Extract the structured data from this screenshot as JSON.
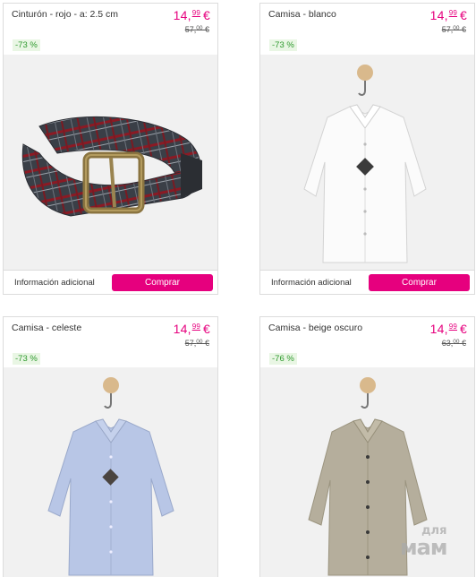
{
  "products": [
    {
      "title": "Cinturón - rojo - a: 2.5 cm",
      "price_int": "14,",
      "price_dec": "99",
      "currency": "€",
      "old_int": "57,",
      "old_dec": "00",
      "old_currency": "€",
      "discount": "-73 %",
      "info_label": "Información adicional",
      "buy_label": "Comprar"
    },
    {
      "title": "Camisa - blanco",
      "price_int": "14,",
      "price_dec": "99",
      "currency": "€",
      "old_int": "57,",
      "old_dec": "00",
      "old_currency": "€",
      "discount": "-73 %",
      "info_label": "Información adicional",
      "buy_label": "Comprar"
    },
    {
      "title": "Camisa - celeste",
      "price_int": "14,",
      "price_dec": "99",
      "currency": "€",
      "old_int": "57,",
      "old_dec": "00",
      "old_currency": "€",
      "discount": "-73 %"
    },
    {
      "title": "Camisa - beige oscuro",
      "price_int": "14,",
      "price_dec": "99",
      "currency": "€",
      "old_int": "63,",
      "old_dec": "00",
      "old_currency": "€",
      "discount": "-76 %"
    }
  ],
  "watermark": {
    "line1": "для",
    "line2": "мам"
  },
  "colors": {
    "accent": "#e6007e",
    "discount_text": "#2f9a2f",
    "discount_bg": "#e9f6e4"
  }
}
